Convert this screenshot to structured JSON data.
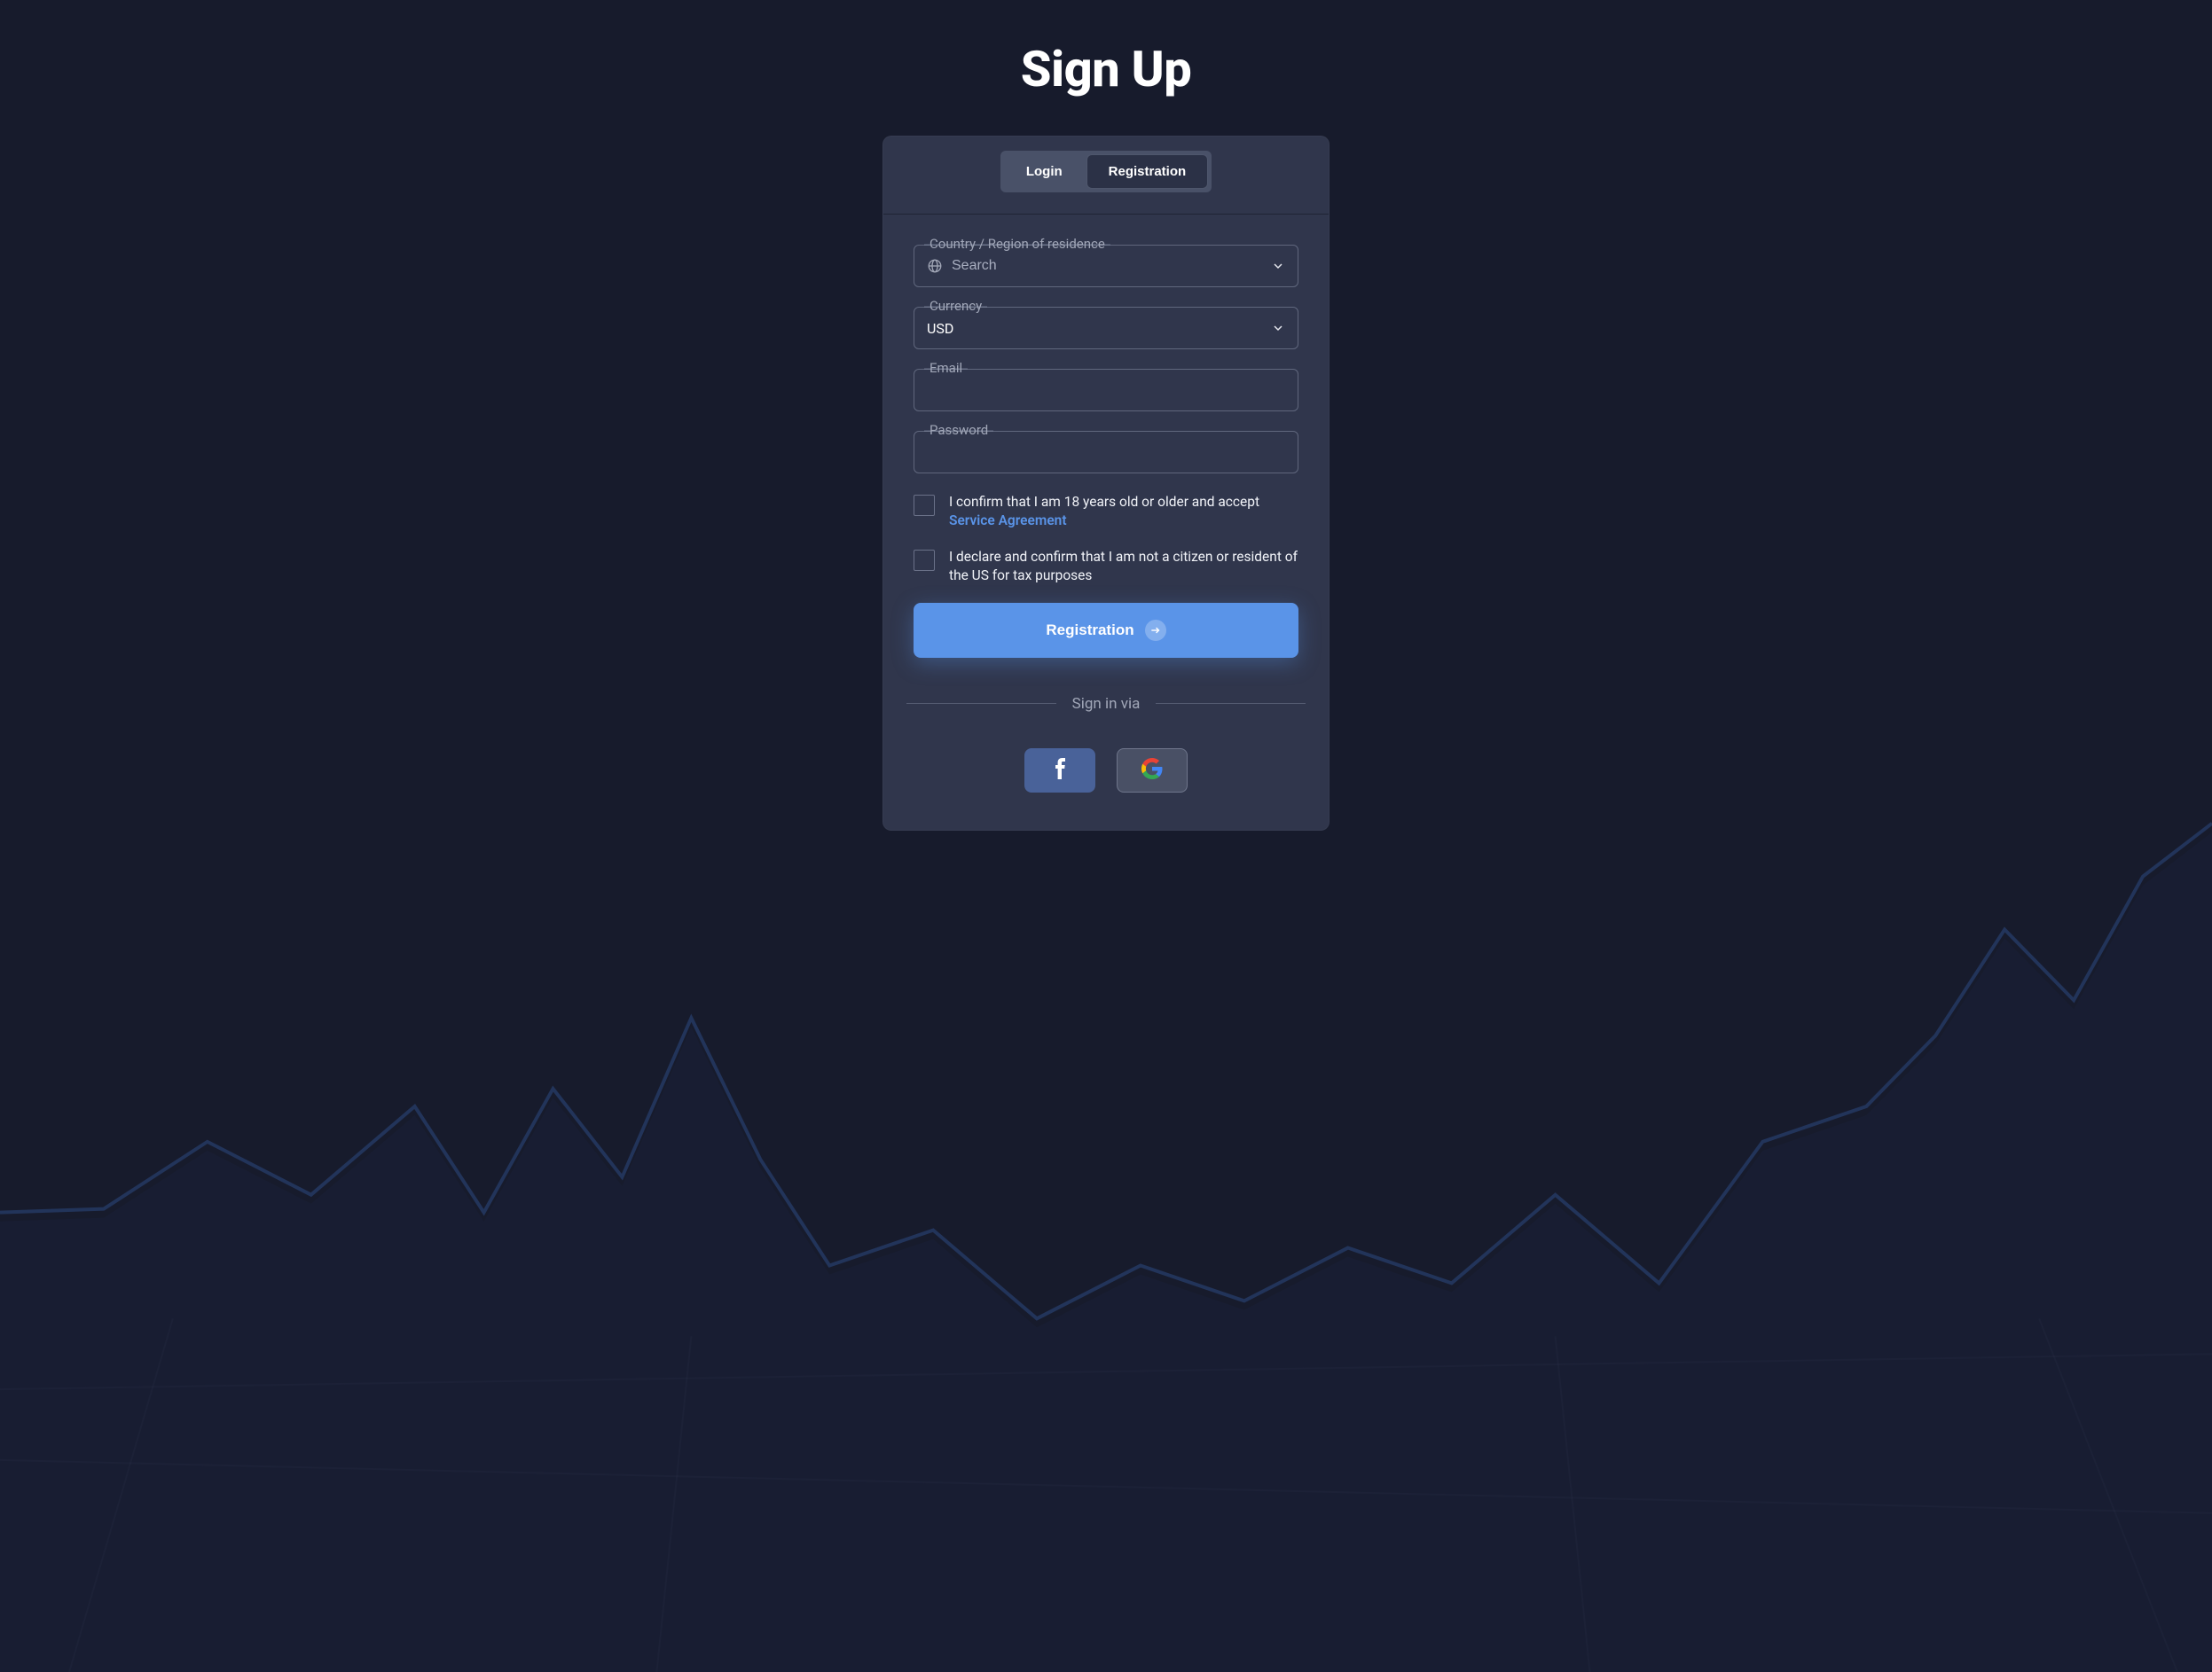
{
  "page": {
    "title": "Sign Up"
  },
  "tabs": {
    "login": "Login",
    "registration": "Registration"
  },
  "form": {
    "country": {
      "label": "Country / Region of residence",
      "placeholder": "Search",
      "value": ""
    },
    "currency": {
      "label": "Currency",
      "value": "USD"
    },
    "email": {
      "label": "Email",
      "value": ""
    },
    "password": {
      "label": "Password",
      "value": ""
    },
    "agreement": {
      "text_prefix": "I confirm that I am 18 years old or older and accept ",
      "link_text": "Service Agreement"
    },
    "us_declaration": {
      "text": "I declare and confirm that I am not a citizen or resident of the US for tax purposes"
    },
    "submit_label": "Registration"
  },
  "social": {
    "divider_label": "Sign in via"
  }
}
